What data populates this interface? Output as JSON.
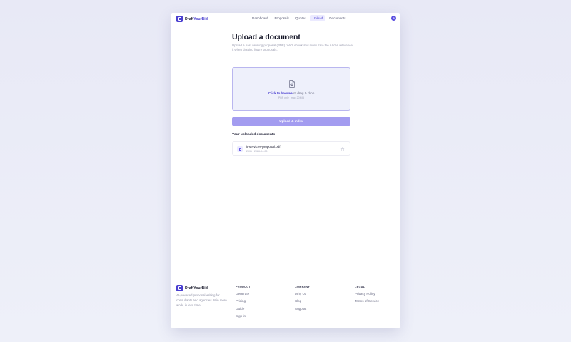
{
  "brand": {
    "name_part1": "Draft",
    "name_part2": "YourBid"
  },
  "nav": {
    "items": [
      {
        "label": "Dashboard",
        "active": false
      },
      {
        "label": "Proposals",
        "active": false
      },
      {
        "label": "Quotes",
        "active": false
      },
      {
        "label": "Upload",
        "active": true
      },
      {
        "label": "Documents",
        "active": false
      }
    ],
    "avatar_initial": "B"
  },
  "main": {
    "title": "Upload a document",
    "subtitle": "Upload a past winning proposal (PDF). We'll chunk and index it so the AI can reference it when drafting future proposals.",
    "dropzone": {
      "link_text": "Click to browse",
      "rest_text": " or drag & drop",
      "hint": "PDF only · max 20 MB",
      "icon": "file-download-icon"
    },
    "upload_button": "Upload & index",
    "uploaded_title": "Your uploaded documents",
    "documents": [
      {
        "name": "it-services-proposal.pdf",
        "meta": "2 KB · 2026-04-08",
        "icon": "file-icon"
      }
    ]
  },
  "footer": {
    "description": "AI-powered proposal writing for consultants and agencies. Win more work, in less time.",
    "columns": [
      {
        "title": "PRODUCT",
        "links": [
          "Generate",
          "Pricing",
          "Guide",
          "Sign in"
        ]
      },
      {
        "title": "COMPANY",
        "links": [
          "Why Us",
          "Blog",
          "Support"
        ]
      },
      {
        "title": "LEGAL",
        "links": [
          "Privacy Policy",
          "Terms of Service"
        ]
      }
    ]
  },
  "colors": {
    "accent": "#4a3fd0",
    "button_disabled": "#a39cf0",
    "dropzone_bg": "#eef0fb"
  }
}
